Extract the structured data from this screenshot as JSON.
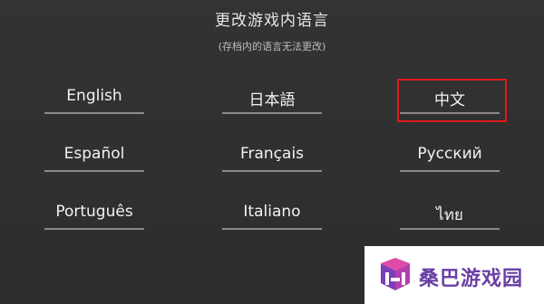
{
  "dialog": {
    "title": "更改游戏内语言",
    "subtitle": "(存档内的语言无法更改)"
  },
  "languages": [
    {
      "label": "English"
    },
    {
      "label": "日本語"
    },
    {
      "label": "中文",
      "selected": true
    },
    {
      "label": "Español"
    },
    {
      "label": "Français"
    },
    {
      "label": "Русский"
    },
    {
      "label": "Português"
    },
    {
      "label": "Italiano"
    },
    {
      "label": "ไทย"
    }
  ],
  "colors": {
    "background": "#2f2f2f",
    "text": "#f2f2f2",
    "underline": "#8a8a8a",
    "selection_highlight": "#e0191b",
    "watermark_text": "#6a3fa6"
  },
  "watermark": {
    "text": "桑巴游戏园",
    "icon": "sangba-logo-icon"
  }
}
